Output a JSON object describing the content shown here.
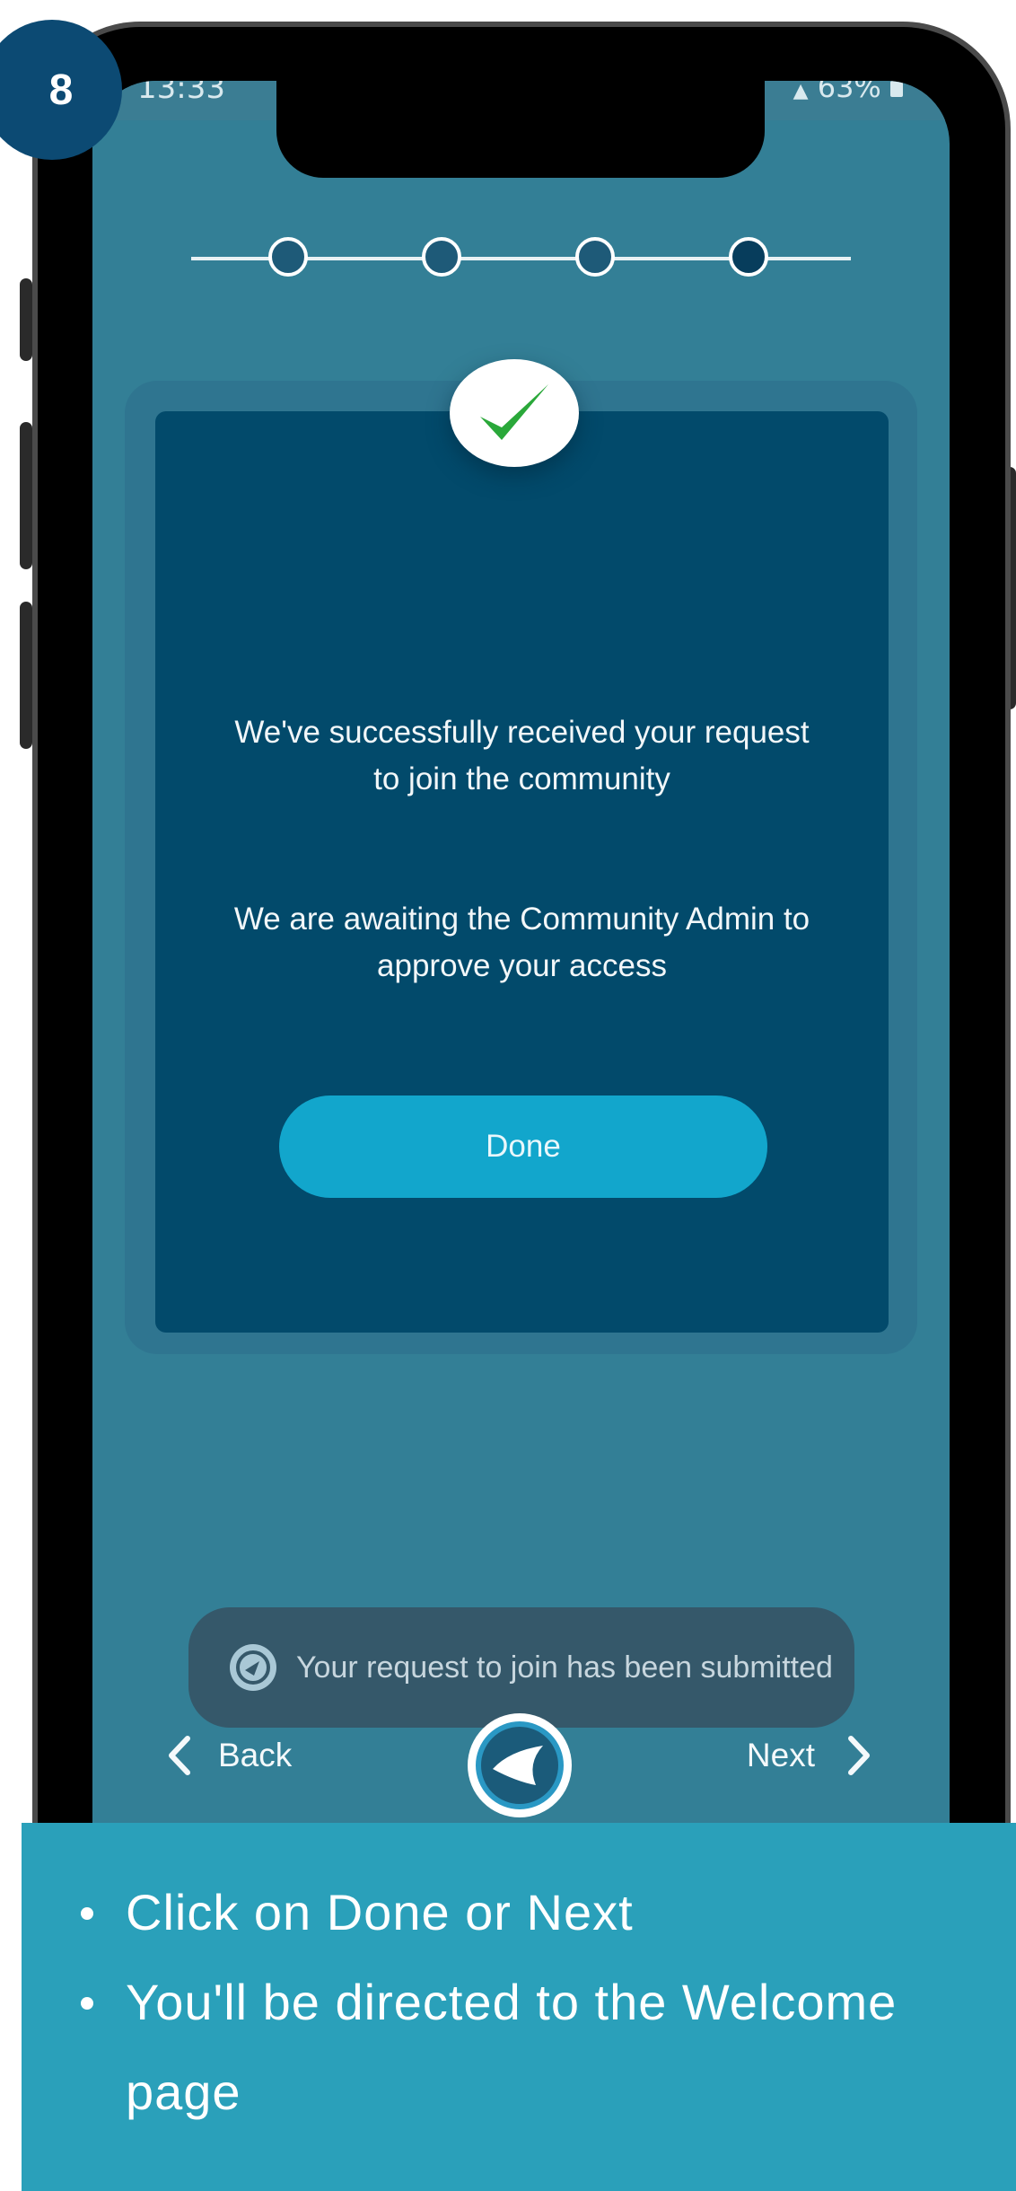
{
  "step_number": "8",
  "status_bar": {
    "time": "13:33",
    "right": "·   ▎▎ 63%"
  },
  "stepper": {
    "steps": 4,
    "current": 4
  },
  "card": {
    "message1": "We've successfully received your request to join the community",
    "message2": "We are awaiting the Community Admin to approve your access",
    "done_label": "Done"
  },
  "toast": {
    "text": "Your request to join has been submitted"
  },
  "nav": {
    "back_label": "Back",
    "next_label": "Next"
  },
  "caption": {
    "items": [
      "Click on Done or Next",
      "You'll be directed to the Welcome page"
    ]
  },
  "colors": {
    "screen_bg": "#337f96",
    "card_bg": "#024a6b",
    "button_bg": "#12a6cc",
    "caption_bg": "#2aa0ba",
    "badge_bg": "#0c4a73",
    "check": "#2aa83a"
  }
}
